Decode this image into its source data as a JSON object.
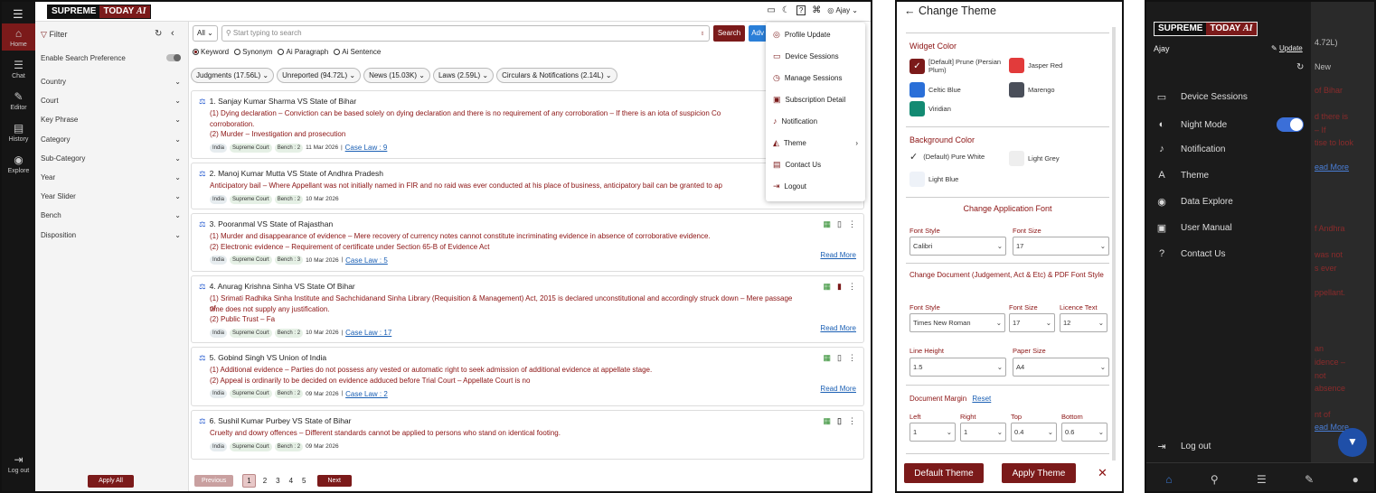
{
  "app": {
    "logo_a": "SUPREME",
    "logo_b": "TODAY",
    "logo_ai": "AI"
  },
  "rail": {
    "items": [
      {
        "label": "Home",
        "icon": "home-icon",
        "glyph": "⌂"
      },
      {
        "label": "Chat",
        "icon": "chat-icon",
        "glyph": "☰"
      },
      {
        "label": "Editor",
        "icon": "editor-icon",
        "glyph": "✎"
      },
      {
        "label": "History",
        "icon": "history-icon",
        "glyph": "▤"
      },
      {
        "label": "Explore",
        "icon": "explore-icon",
        "glyph": "◉"
      }
    ],
    "logout": "Log out"
  },
  "topbar": {
    "user": "Ajay"
  },
  "filter": {
    "title": "Filter",
    "enable": "Enable Search Preference",
    "fields": [
      "Country",
      "Court",
      "Key Phrase",
      "Category",
      "Sub-Category",
      "Year",
      "Year Slider",
      "Bench",
      "Disposition"
    ],
    "apply": "Apply All"
  },
  "search": {
    "scope": "All",
    "placeholder": "Start typing to search",
    "button": "Search",
    "adv": "Adv",
    "radios": [
      "Keyword",
      "Synonym",
      "Ai Paragraph",
      "Ai Sentence"
    ]
  },
  "chips": [
    "Judgments (17.56L)",
    "Unreported (94.72L)",
    "News (15.03K)",
    "Laws (2.59L)",
    "Circulars & Notifications (2.14L)"
  ],
  "cards": [
    {
      "title": "1. Sanjay Kumar Sharma VS State of Bihar",
      "lines": [
        "(1) Dying declaration – Conviction can be based solely on dying declaration and there is no requirement of any corroboration – If there is an iota of suspicion Co",
        "corroboration.",
        "(2) Murder – Investigation and prosecution"
      ],
      "tags": [
        "India",
        "Supreme Court",
        "Bench : 2"
      ],
      "date": "11 Mar 2026",
      "case": "Case Law : 9",
      "readmore": ""
    },
    {
      "title": "2. Manoj Kumar Mutta VS State of Andhra Pradesh",
      "lines": [
        "Anticipatory bail – Where Appellant was not initially named in FIR and no raid was ever conducted at his place of business, anticipatory bail can be granted to ap"
      ],
      "tags": [
        "India",
        "Supreme Court",
        "Bench : 2"
      ],
      "date": "10 Mar 2026",
      "case": "",
      "readmore": ""
    },
    {
      "title": "3. Pooranmal VS State of Rajasthan",
      "lines": [
        "(1) Murder and disappearance of evidence – Mere recovery of currency notes cannot constitute incriminating evidence in absence of corroborative evidence.",
        "(2) Electronic evidence – Requirement of certificate under Section 65-B of Evidence Act"
      ],
      "tags": [
        "India",
        "Supreme Court",
        "Bench : 3"
      ],
      "date": "10 Mar 2026",
      "case": "Case Law : 5",
      "readmore": "Read More"
    },
    {
      "title": "4. Anurag Krishna Sinha VS State Of Bihar",
      "lines": [
        "(1) Srimati Radhika Sinha Institute and Sachchidanand Sinha Library (Requisition & Management) Act, 2015 is declared unconstitutional and accordingly struck down – Mere passage of",
        "time does not supply any justification.",
        "(2) Public Trust – Fa"
      ],
      "tags": [
        "India",
        "Supreme Court",
        "Bench : 2"
      ],
      "date": "10 Mar 2026",
      "case": "Case Law : 17",
      "readmore": "Read More"
    },
    {
      "title": "5. Gobind Singh VS Union of India",
      "lines": [
        "(1) Additional evidence – Parties do not possess any vested or automatic right to seek admission of additional evidence at appellate stage.",
        "(2) Appeal is ordinarily to be decided on evidence adduced before Trial Court – Appellate Court is no"
      ],
      "tags": [
        "India",
        "Supreme Court",
        "Bench : 2"
      ],
      "date": "09 Mar 2026",
      "case": "Case Law : 2",
      "readmore": "Read More"
    },
    {
      "title": "6. Sushil Kumar Purbey VS State of Bihar",
      "lines": [
        "Cruelty and dowry offences – Different standards cannot be applied to persons who stand on identical footing."
      ],
      "tags": [
        "India",
        "Supreme Court",
        "Bench : 2"
      ],
      "date": "09 Mar 2026",
      "case": "",
      "readmore": ""
    }
  ],
  "pager": {
    "prev": "Previous",
    "pages": [
      "1",
      "2",
      "3",
      "4",
      "5"
    ],
    "next": "Next"
  },
  "menu": [
    "Profile Update",
    "Device Sessions",
    "Manage Sessions",
    "Subscription Detail",
    "Notification",
    "Theme",
    "Contact Us",
    "Logout"
  ],
  "theme": {
    "title": "Change Theme",
    "widget_color": "Widget Color",
    "widget_swatches": [
      {
        "label": "[Default] Prune (Persian Plum)",
        "color": "#7b1a1a"
      },
      {
        "label": "Jasper Red",
        "color": "#e23b3b"
      },
      {
        "label": "Celtic Blue",
        "color": "#2a6fd8"
      },
      {
        "label": "Marengo",
        "color": "#4a4f5a"
      },
      {
        "label": "Viridian",
        "color": "#138a72"
      }
    ],
    "background_color": "Background Color",
    "bg_options": [
      {
        "label": "(Default) Pure White",
        "color": "#ffffff"
      },
      {
        "label": "Light Grey",
        "color": "#eeeeee"
      },
      {
        "label": "Light Blue",
        "color": "#eef2f8"
      }
    ],
    "app_font": "Change Application Font",
    "font_style": "Font Style",
    "font_size": "Font Size",
    "app_font_style": "Calibri",
    "app_font_size": "17",
    "doc_font": "Change Document (Judgement, Act & Etc) & PDF Font Style",
    "doc_font_style": "Times New Roman",
    "doc_font_size": "17",
    "licence_text": "Licence Text",
    "licence_value": "12",
    "line_height": "Line Height",
    "line_height_value": "1.5",
    "paper_size": "Paper Size",
    "paper_size_value": "A4",
    "doc_margin": "Document Margin",
    "reset": "Reset",
    "margin_labels": [
      "Left",
      "Right",
      "Top",
      "Bottom"
    ],
    "margin_values": [
      "1",
      "1",
      "0.4",
      "0.6"
    ],
    "default_btn": "Default Theme",
    "apply_btn": "Apply Theme"
  },
  "dark": {
    "user": "Ajay",
    "update": "Update",
    "items": [
      {
        "label": "Device Sessions",
        "icon": "devices-icon",
        "glyph": "▭"
      },
      {
        "label": "Night Mode",
        "icon": "palette-icon",
        "glyph": "◐"
      },
      {
        "label": "Notification",
        "icon": "bell-icon",
        "glyph": "♪"
      },
      {
        "label": "Theme",
        "icon": "theme-icon",
        "glyph": "A"
      },
      {
        "label": "Data Explore",
        "icon": "compass-icon",
        "glyph": "◉"
      },
      {
        "label": "User Manual",
        "icon": "book-icon",
        "glyph": "▣"
      },
      {
        "label": "Contact Us",
        "icon": "help-icon",
        "glyph": "?"
      }
    ],
    "logout": "Log out",
    "behind": [
      "4.72L)",
      "New",
      "of Bihar",
      "d there is",
      "– If",
      "tise to look",
      "ead More",
      "f Andhra",
      "was not",
      "s ever",
      "ppellant.",
      "an",
      "idence –",
      "not",
      "absence",
      "nt of",
      "ead More"
    ]
  }
}
